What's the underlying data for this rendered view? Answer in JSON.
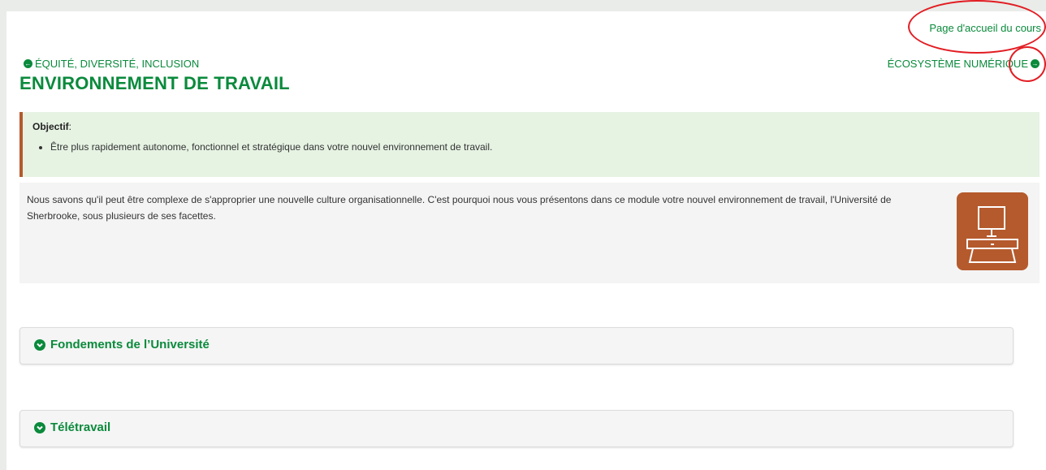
{
  "header": {
    "home_link": "Page d'accueil du cours"
  },
  "nav": {
    "prev_label": "ÉQUITÉ, DIVERSITÉ, INCLUSION",
    "next_label": "ÉCOSYSTÈME NUMÉRIQUE",
    "prev_icon": "arrow-left-circle-icon",
    "next_icon": "arrow-right-circle-icon"
  },
  "page": {
    "title": "ENVIRONNEMENT DE TRAVAIL"
  },
  "objective": {
    "label": "Objectif",
    "suffix": ":",
    "items": [
      "Être plus rapidement autonome, fonctionnel et stratégique dans votre nouvel environnement de travail."
    ]
  },
  "intro": {
    "text": "Nous savons qu'il peut être complexe de s'approprier une nouvelle culture organisationnelle. C'est pourquoi nous vous présentons dans ce module votre nouvel environnement de travail, l'Université de Sherbrooke, sous plusieurs de ses facettes.",
    "icon": "computer-desk-icon"
  },
  "sections": [
    {
      "title": "Fondements de l’Université",
      "icon": "chevron-down-circle-icon"
    },
    {
      "title": "Télétravail",
      "icon": "chevron-down-circle-icon"
    }
  ],
  "colors": {
    "accent_green": "#0a8a3c",
    "objective_bg": "#e6f3e3",
    "objective_border": "#b55a2d",
    "icon_bg": "#b55a2d",
    "annotation_red": "#e21d23"
  }
}
